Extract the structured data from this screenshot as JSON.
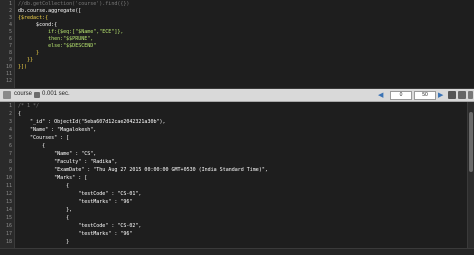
{
  "editor": {
    "lines": [
      "//db.getCollection('course').find({})",
      "db.course.aggregate([",
      "{$redact:{",
      "      $cond:{",
      "          if:{$eq:[\"$Name\",\"ECE\"]},",
      "          then:\"$$PRUNE\",",
      "          else:\"$$DESCEND\"",
      "      }",
      "   }}",
      "}])",
      "",
      ""
    ]
  },
  "toolbar": {
    "collection": "course",
    "time": "0.001 sec.",
    "page_from": "0",
    "page_size": "50"
  },
  "results": {
    "lines": [
      "/* 1 */",
      "{",
      "    \"_id\" : ObjectId(\"5eba607d12cae2042321a30b\"),",
      "    \"Name\" : \"Magalokesh\",",
      "    \"Courses\" : [",
      "        {",
      "            \"Name\" : \"CS\",",
      "            \"Faculty\" : \"Radika\",",
      "            \"ExamDate\" : \"Thu Aug 27 2015 00:00:00 GMT+0530 (India Standard Time)\",",
      "            \"Marks\" : [",
      "                {",
      "                    \"testCode\" : \"CS-01\",",
      "                    \"testMarks\" : \"96\"",
      "                },",
      "                {",
      "                    \"testCode\" : \"CS-02\",",
      "                    \"testMarks\" : \"96\"",
      "                }"
    ]
  },
  "colors": {
    "editor_bg": "#1e1e1e",
    "toolbar_bg": "#d9d9d9",
    "highlight": "#f3d44a",
    "keyword": "#b6e36f"
  }
}
